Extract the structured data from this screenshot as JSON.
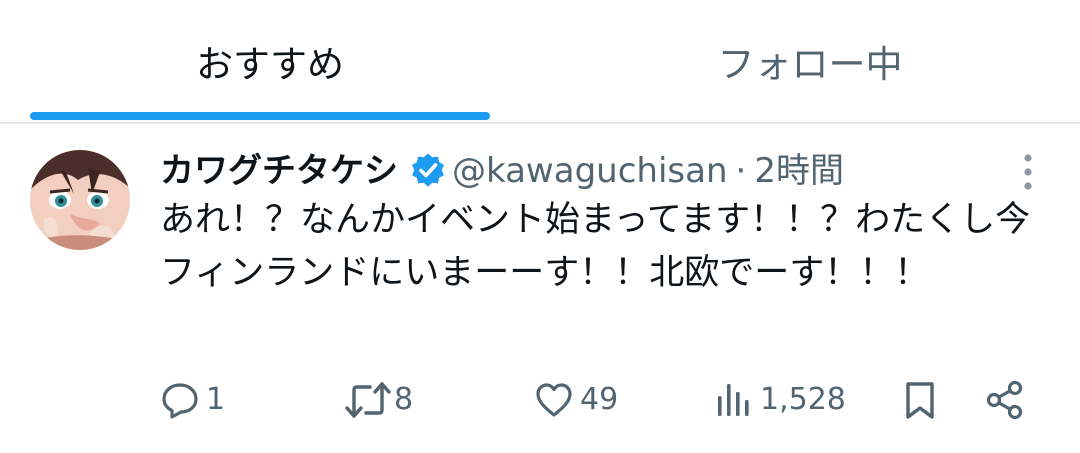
{
  "tabs": [
    {
      "label": "おすすめ",
      "active": true
    },
    {
      "label": "フォロー中",
      "active": false
    }
  ],
  "post": {
    "display_name": "カワグチタケシ",
    "verified": true,
    "handle": "@kawaguchisan",
    "separator": "·",
    "time": "2時間",
    "text": "あれ！？なんかイベント始まってます！！？わたくし今フィンランドにいまーーす！！北欧でーす！！！",
    "actions": {
      "reply_count": "1",
      "repost_count": "8",
      "like_count": "49",
      "views_count": "1,528"
    }
  },
  "colors": {
    "accent": "#1d9bf0",
    "text_primary": "#0f1419",
    "text_secondary": "#536471",
    "divider": "#e1e6ea"
  },
  "icons": [
    "verified-badge-icon",
    "more-icon",
    "reply-icon",
    "repost-icon",
    "like-icon",
    "views-icon",
    "bookmark-icon",
    "share-icon"
  ]
}
